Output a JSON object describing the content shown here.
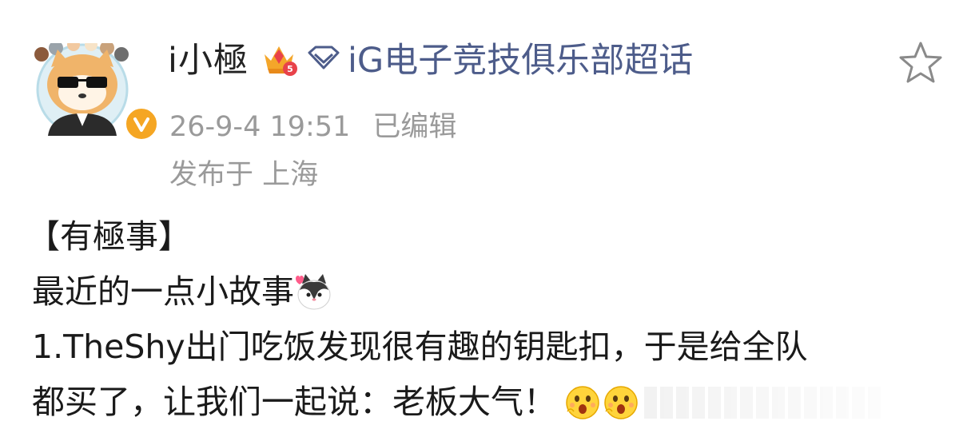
{
  "author": {
    "name": "i小極",
    "avatar_icon": "shiba-dog-avatar",
    "badge_icon": "vip-crown-level-5",
    "verified_icon": "orange-verified-v"
  },
  "supertopic": {
    "icon": "diamond-icon",
    "label": "iG电子竞技俱乐部超话",
    "color": "#4d5c8a"
  },
  "post_meta": {
    "timestamp": "26-9-4 19:51",
    "edited_label": "已编辑",
    "location": "发布于 上海"
  },
  "actions": {
    "favorite_icon": "star-outline-icon"
  },
  "post": {
    "line1": "【有極事】",
    "line2": "最近的一点小故事",
    "line3": "1.TheShy出门吃饭发现很有趣的钥匙扣，于是给全队",
    "line4": "都买了，让我们一起说：老板大气！",
    "emoji_cat": "cat-with-heart-emoji",
    "emoji_surprise": "surprised-face-emoji"
  }
}
